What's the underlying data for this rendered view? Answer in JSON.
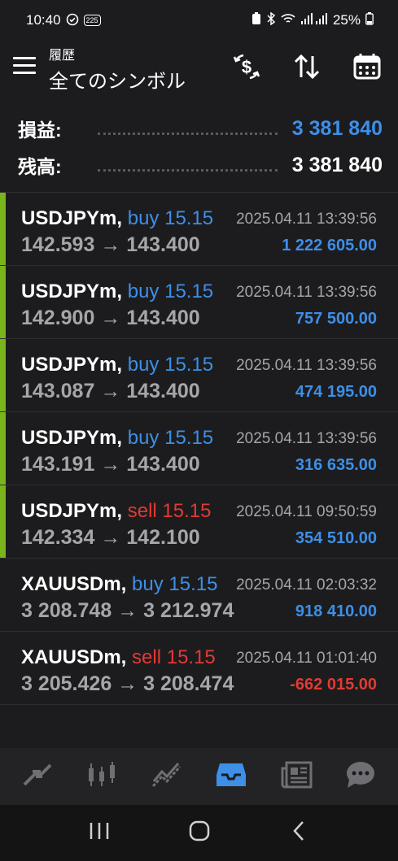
{
  "status_bar": {
    "time": "10:40",
    "notif_badge": "225",
    "battery": "25%"
  },
  "header": {
    "subtitle": "履歴",
    "title": "全てのシンボル"
  },
  "summary": {
    "profit_label": "損益:",
    "profit_value": "3 381 840",
    "balance_label": "残高:",
    "balance_value": "3 381 840"
  },
  "trades": [
    {
      "symbol": "USDJPYm,",
      "side": "buy",
      "lot": "15.15",
      "time": "2025.04.11 13:39:56",
      "open": "142.593",
      "close": "143.400",
      "profit": "1 222 605.00",
      "accent": true
    },
    {
      "symbol": "USDJPYm,",
      "side": "buy",
      "lot": "15.15",
      "time": "2025.04.11 13:39:56",
      "open": "142.900",
      "close": "143.400",
      "profit": "757 500.00",
      "accent": true
    },
    {
      "symbol": "USDJPYm,",
      "side": "buy",
      "lot": "15.15",
      "time": "2025.04.11 13:39:56",
      "open": "143.087",
      "close": "143.400",
      "profit": "474 195.00",
      "accent": true
    },
    {
      "symbol": "USDJPYm,",
      "side": "buy",
      "lot": "15.15",
      "time": "2025.04.11 13:39:56",
      "open": "143.191",
      "close": "143.400",
      "profit": "316 635.00",
      "accent": true
    },
    {
      "symbol": "USDJPYm,",
      "side": "sell",
      "lot": "15.15",
      "time": "2025.04.11 09:50:59",
      "open": "142.334",
      "close": "142.100",
      "profit": "354 510.00",
      "accent": true
    },
    {
      "symbol": "XAUUSDm,",
      "side": "buy",
      "lot": "15.15",
      "time": "2025.04.11 02:03:32",
      "open": "3 208.748",
      "close": "3 212.974",
      "profit": "918 410.00",
      "accent": false
    },
    {
      "symbol": "XAUUSDm,",
      "side": "sell",
      "lot": "15.15",
      "time": "2025.04.11 01:01:40",
      "open": "3 205.426",
      "close": "3 208.474",
      "profit": "-662 015.00",
      "accent": false
    }
  ],
  "arrow": "→",
  "nav": [
    "quotes-icon",
    "chart-icon",
    "trade-icon",
    "history-icon",
    "news-icon",
    "chat-icon"
  ],
  "colors": {
    "accent": "#3d8fe8",
    "sell": "#e23a35",
    "bar": "#79b51a",
    "bg": "#1c1c1e"
  }
}
